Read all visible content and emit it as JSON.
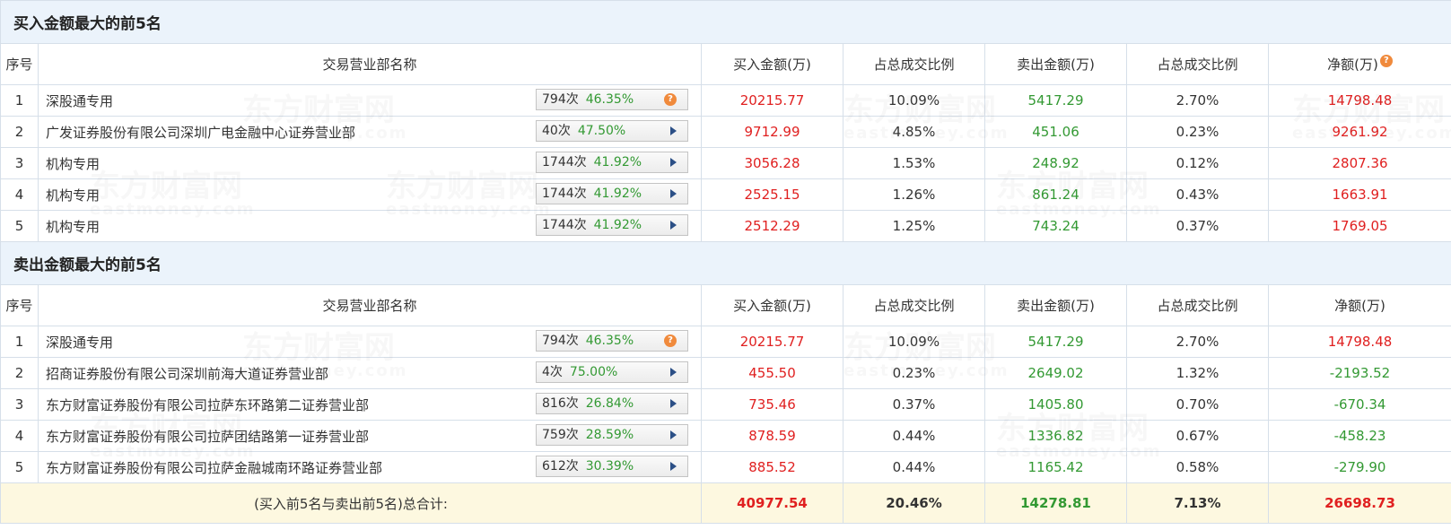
{
  "sections": [
    {
      "title": "买入金额最大的前5名",
      "rows": [
        {
          "idx": "1",
          "name": "深股通专用",
          "times": "794次",
          "pct": "46.35%",
          "icon": "question-icon",
          "buy": "20215.77",
          "buy_ratio": "10.09%",
          "sell": "5417.29",
          "sell_ratio": "2.70%",
          "net": "14798.48"
        },
        {
          "idx": "2",
          "name": "广发证券股份有限公司深圳广电金融中心证券营业部",
          "times": "40次",
          "pct": "47.50%",
          "icon": "arrow-icon",
          "buy": "9712.99",
          "buy_ratio": "4.85%",
          "sell": "451.06",
          "sell_ratio": "0.23%",
          "net": "9261.92"
        },
        {
          "idx": "3",
          "name": "机构专用",
          "times": "1744次",
          "pct": "41.92%",
          "icon": "arrow-icon",
          "buy": "3056.28",
          "buy_ratio": "1.53%",
          "sell": "248.92",
          "sell_ratio": "0.12%",
          "net": "2807.36"
        },
        {
          "idx": "4",
          "name": "机构专用",
          "times": "1744次",
          "pct": "41.92%",
          "icon": "arrow-icon",
          "buy": "2525.15",
          "buy_ratio": "1.26%",
          "sell": "861.24",
          "sell_ratio": "0.43%",
          "net": "1663.91"
        },
        {
          "idx": "5",
          "name": "机构专用",
          "times": "1744次",
          "pct": "41.92%",
          "icon": "arrow-icon",
          "buy": "2512.29",
          "buy_ratio": "1.25%",
          "sell": "743.24",
          "sell_ratio": "0.37%",
          "net": "1769.05"
        }
      ]
    },
    {
      "title": "卖出金额最大的前5名",
      "rows": [
        {
          "idx": "1",
          "name": "深股通专用",
          "times": "794次",
          "pct": "46.35%",
          "icon": "question-icon",
          "buy": "20215.77",
          "buy_ratio": "10.09%",
          "sell": "5417.29",
          "sell_ratio": "2.70%",
          "net": "14798.48"
        },
        {
          "idx": "2",
          "name": "招商证券股份有限公司深圳前海大道证券营业部",
          "times": "4次",
          "pct": "75.00%",
          "icon": "arrow-icon",
          "buy": "455.50",
          "buy_ratio": "0.23%",
          "sell": "2649.02",
          "sell_ratio": "1.32%",
          "net": "-2193.52"
        },
        {
          "idx": "3",
          "name": "东方财富证券股份有限公司拉萨东环路第二证券营业部",
          "times": "816次",
          "pct": "26.84%",
          "icon": "arrow-icon",
          "buy": "735.46",
          "buy_ratio": "0.37%",
          "sell": "1405.80",
          "sell_ratio": "0.70%",
          "net": "-670.34"
        },
        {
          "idx": "4",
          "name": "东方财富证券股份有限公司拉萨团结路第一证券营业部",
          "times": "759次",
          "pct": "28.59%",
          "icon": "arrow-icon",
          "buy": "878.59",
          "buy_ratio": "0.44%",
          "sell": "1336.82",
          "sell_ratio": "0.67%",
          "net": "-458.23"
        },
        {
          "idx": "5",
          "name": "东方财富证券股份有限公司拉萨金融城南环路证券营业部",
          "times": "612次",
          "pct": "30.39%",
          "icon": "arrow-icon",
          "buy": "885.52",
          "buy_ratio": "0.44%",
          "sell": "1165.42",
          "sell_ratio": "0.58%",
          "net": "-279.90"
        }
      ]
    }
  ],
  "headers": {
    "idx": "序号",
    "name": "交易营业部名称",
    "buy": "买入金额(万)",
    "buy_ratio": "占总成交比例",
    "sell": "卖出金额(万)",
    "sell_ratio": "占总成交比例",
    "net": "净额(万)",
    "net_icon": "question-icon"
  },
  "total": {
    "label": "(买入前5名与卖出前5名)总合计:",
    "buy": "40977.54",
    "buy_ratio": "20.46%",
    "sell": "14278.81",
    "sell_ratio": "7.13%",
    "net": "26698.73"
  },
  "colors": {
    "positive": "#e02020",
    "negative": "#339933",
    "header_bg": "#ebf3fb",
    "total_bg": "#fdf8e0",
    "icon_orange": "#f08a3c",
    "arrow_blue": "#2b4f86"
  },
  "watermark": {
    "text": "东方财富网",
    "sub": "eastmoney.com"
  }
}
